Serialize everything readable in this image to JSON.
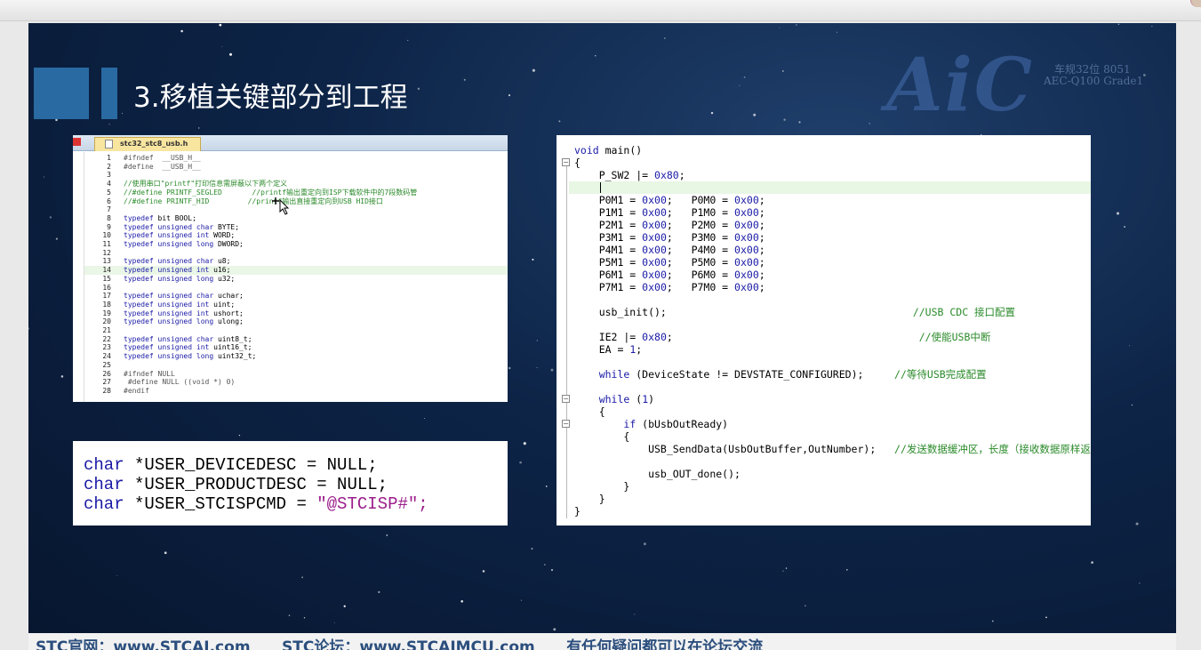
{
  "slide": {
    "title": "3.移植关键部分到工程",
    "logo": "AiC",
    "logo_sub1": "车规32位 8051",
    "logo_sub2": "AEC-Q100 Grade1",
    "footer": "STC官网：www.STCAI.com      STC论坛：www.STCAIMCU.com      有任何疑问都可以在论坛交流"
  },
  "header_file": {
    "tab_label": "stc32_stc8_usb.h",
    "lines": [
      {
        "n": "1",
        "segs": [
          [
            "pp",
            "#ifndef  __USB_H__"
          ]
        ]
      },
      {
        "n": "2",
        "segs": [
          [
            "pp",
            "#define  __USB_H__"
          ]
        ]
      },
      {
        "n": "3",
        "segs": []
      },
      {
        "n": "4",
        "segs": [
          [
            "cm",
            "//使用串口\"printf\"打印信息需屏蔽以下两个定义"
          ]
        ]
      },
      {
        "n": "5",
        "segs": [
          [
            "cm",
            "//#define PRINTF_SEGLED       //printf输出重定向到ISP下载软件中的7段数码管"
          ]
        ]
      },
      {
        "n": "6",
        "segs": [
          [
            "cm",
            "//#define PRINTF_HID         //printf输出直接重定向到USB HID接口"
          ]
        ]
      },
      {
        "n": "7",
        "segs": []
      },
      {
        "n": "8",
        "segs": [
          [
            "kw",
            "typedef"
          ],
          [
            "",
            " bit BOOL;"
          ]
        ]
      },
      {
        "n": "9",
        "segs": [
          [
            "kw",
            "typedef unsigned char"
          ],
          [
            "",
            " BYTE;"
          ]
        ]
      },
      {
        "n": "10",
        "segs": [
          [
            "kw",
            "typedef unsigned int"
          ],
          [
            "",
            " WORD;"
          ]
        ]
      },
      {
        "n": "11",
        "segs": [
          [
            "kw",
            "typedef unsigned long"
          ],
          [
            "",
            " DWORD;"
          ]
        ]
      },
      {
        "n": "12",
        "segs": []
      },
      {
        "n": "13",
        "segs": [
          [
            "kw",
            "typedef unsigned char"
          ],
          [
            "",
            " u8;"
          ]
        ]
      },
      {
        "n": "14",
        "segs": [
          [
            "kw",
            "typedef unsigned int"
          ],
          [
            "",
            " u16;"
          ]
        ],
        "hl": true
      },
      {
        "n": "15",
        "segs": [
          [
            "kw",
            "typedef unsigned long"
          ],
          [
            "",
            " u32;"
          ]
        ]
      },
      {
        "n": "16",
        "segs": []
      },
      {
        "n": "17",
        "segs": [
          [
            "kw",
            "typedef unsigned char"
          ],
          [
            "",
            " uchar;"
          ]
        ]
      },
      {
        "n": "18",
        "segs": [
          [
            "kw",
            "typedef unsigned int"
          ],
          [
            "",
            " uint;"
          ]
        ]
      },
      {
        "n": "19",
        "segs": [
          [
            "kw",
            "typedef unsigned int"
          ],
          [
            "",
            " ushort;"
          ]
        ]
      },
      {
        "n": "20",
        "segs": [
          [
            "kw",
            "typedef unsigned long"
          ],
          [
            "",
            " ulong;"
          ]
        ]
      },
      {
        "n": "21",
        "segs": []
      },
      {
        "n": "22",
        "segs": [
          [
            "kw",
            "typedef unsigned char"
          ],
          [
            "",
            " uint8_t;"
          ]
        ]
      },
      {
        "n": "23",
        "segs": [
          [
            "kw",
            "typedef unsigned int"
          ],
          [
            "",
            " uint16_t;"
          ]
        ]
      },
      {
        "n": "24",
        "segs": [
          [
            "kw",
            "typedef unsigned long"
          ],
          [
            "",
            " uint32_t;"
          ]
        ]
      },
      {
        "n": "25",
        "segs": []
      },
      {
        "n": "26",
        "segs": [
          [
            "pp",
            "#ifndef NULL"
          ]
        ]
      },
      {
        "n": "27",
        "segs": [
          [
            "pp",
            " #define NULL ((void *) 0)"
          ]
        ]
      },
      {
        "n": "28",
        "segs": [
          [
            "pp",
            "#endif"
          ]
        ]
      }
    ]
  },
  "char_decls": [
    {
      "kw": "char",
      "rest": " *USER_DEVICEDESC = NULL;",
      "str": ""
    },
    {
      "kw": "char",
      "rest": " *USER_PRODUCTDESC = NULL;",
      "str": ""
    },
    {
      "kw": "char",
      "rest": " *USER_STCISPCMD = ",
      "str": "\"@STCISP#\";"
    }
  ],
  "main_code": [
    {
      "segs": [
        [
          "kw",
          "void"
        ],
        [
          "",
          " main()"
        ]
      ]
    },
    {
      "segs": [
        [
          "",
          "{"
        ]
      ]
    },
    {
      "segs": [
        [
          "",
          "    P_SW2 |= "
        ],
        [
          "num",
          "0x80"
        ],
        [
          "",
          ";"
        ]
      ]
    },
    {
      "segs": [
        [
          "",
          ""
        ]
      ]
    },
    {
      "segs": [
        [
          "",
          "    P0M1 = "
        ],
        [
          "num",
          "0x00"
        ],
        [
          "",
          ";   P0M0 = "
        ],
        [
          "num",
          "0x00"
        ],
        [
          "",
          ";"
        ]
      ]
    },
    {
      "segs": [
        [
          "",
          "    P1M1 = "
        ],
        [
          "num",
          "0x00"
        ],
        [
          "",
          ";   P1M0 = "
        ],
        [
          "num",
          "0x00"
        ],
        [
          "",
          ";"
        ]
      ]
    },
    {
      "segs": [
        [
          "",
          "    P2M1 = "
        ],
        [
          "num",
          "0x00"
        ],
        [
          "",
          ";   P2M0 = "
        ],
        [
          "num",
          "0x00"
        ],
        [
          "",
          ";"
        ]
      ]
    },
    {
      "segs": [
        [
          "",
          "    P3M1 = "
        ],
        [
          "num",
          "0x00"
        ],
        [
          "",
          ";   P3M0 = "
        ],
        [
          "num",
          "0x00"
        ],
        [
          "",
          ";"
        ]
      ]
    },
    {
      "segs": [
        [
          "",
          "    P4M1 = "
        ],
        [
          "num",
          "0x00"
        ],
        [
          "",
          ";   P4M0 = "
        ],
        [
          "num",
          "0x00"
        ],
        [
          "",
          ";"
        ]
      ]
    },
    {
      "segs": [
        [
          "",
          "    P5M1 = "
        ],
        [
          "num",
          "0x00"
        ],
        [
          "",
          ";   P5M0 = "
        ],
        [
          "num",
          "0x00"
        ],
        [
          "",
          ";"
        ]
      ]
    },
    {
      "segs": [
        [
          "",
          "    P6M1 = "
        ],
        [
          "num",
          "0x00"
        ],
        [
          "",
          ";   P6M0 = "
        ],
        [
          "num",
          "0x00"
        ],
        [
          "",
          ";"
        ]
      ]
    },
    {
      "segs": [
        [
          "",
          "    P7M1 = "
        ],
        [
          "num",
          "0x00"
        ],
        [
          "",
          ";   P7M0 = "
        ],
        [
          "num",
          "0x00"
        ],
        [
          "",
          ";"
        ]
      ]
    },
    {
      "segs": [
        [
          "",
          ""
        ]
      ]
    },
    {
      "segs": [
        [
          "",
          "    usb_init();                                        "
        ],
        [
          "cm",
          "//USB CDC 接口配置"
        ]
      ]
    },
    {
      "segs": [
        [
          "",
          ""
        ]
      ]
    },
    {
      "segs": [
        [
          "",
          "    IE2 |= "
        ],
        [
          "num",
          "0x80"
        ],
        [
          "",
          ";                                        "
        ],
        [
          "cm",
          "//使能USB中断"
        ]
      ]
    },
    {
      "segs": [
        [
          "",
          "    EA = "
        ],
        [
          "num",
          "1"
        ],
        [
          "",
          ";"
        ]
      ]
    },
    {
      "segs": [
        [
          "",
          ""
        ]
      ]
    },
    {
      "segs": [
        [
          "",
          "    "
        ],
        [
          "kw",
          "while"
        ],
        [
          "",
          " (DeviceState != DEVSTATE_CONFIGURED);     "
        ],
        [
          "cm",
          "//等待USB完成配置"
        ]
      ]
    },
    {
      "segs": [
        [
          "",
          ""
        ]
      ]
    },
    {
      "segs": [
        [
          "",
          "    "
        ],
        [
          "kw",
          "while"
        ],
        [
          "",
          " ("
        ],
        [
          "num",
          "1"
        ],
        [
          "",
          ")"
        ]
      ]
    },
    {
      "segs": [
        [
          "",
          "    {"
        ]
      ]
    },
    {
      "segs": [
        [
          "",
          "        "
        ],
        [
          "kw",
          "if"
        ],
        [
          "",
          " (bUsbOutReady)"
        ]
      ]
    },
    {
      "segs": [
        [
          "",
          "        {"
        ]
      ]
    },
    {
      "segs": [
        [
          "",
          "            USB_SendData(UsbOutBuffer,OutNumber);   "
        ],
        [
          "cm",
          "//发送数据缓冲区，长度（接收数据原样返回，用于测试）"
        ]
      ]
    },
    {
      "segs": [
        [
          "",
          ""
        ]
      ]
    },
    {
      "segs": [
        [
          "",
          "            usb_OUT_done();"
        ]
      ]
    },
    {
      "segs": [
        [
          "",
          "        }"
        ]
      ]
    },
    {
      "segs": [
        [
          "",
          "    }"
        ]
      ]
    },
    {
      "segs": [
        [
          "",
          "}"
        ]
      ]
    }
  ],
  "colors": {
    "slide_bg": "#0d2447",
    "accent_block": "#2f78b4",
    "keyword": "#1a1aa6",
    "comment": "#2a8a2a",
    "string": "#9b1d8a",
    "footer_text": "#2b4e7d"
  },
  "icons": {
    "cursor": "mouse-pointer-icon",
    "fold": "fold-toggle-icon"
  }
}
